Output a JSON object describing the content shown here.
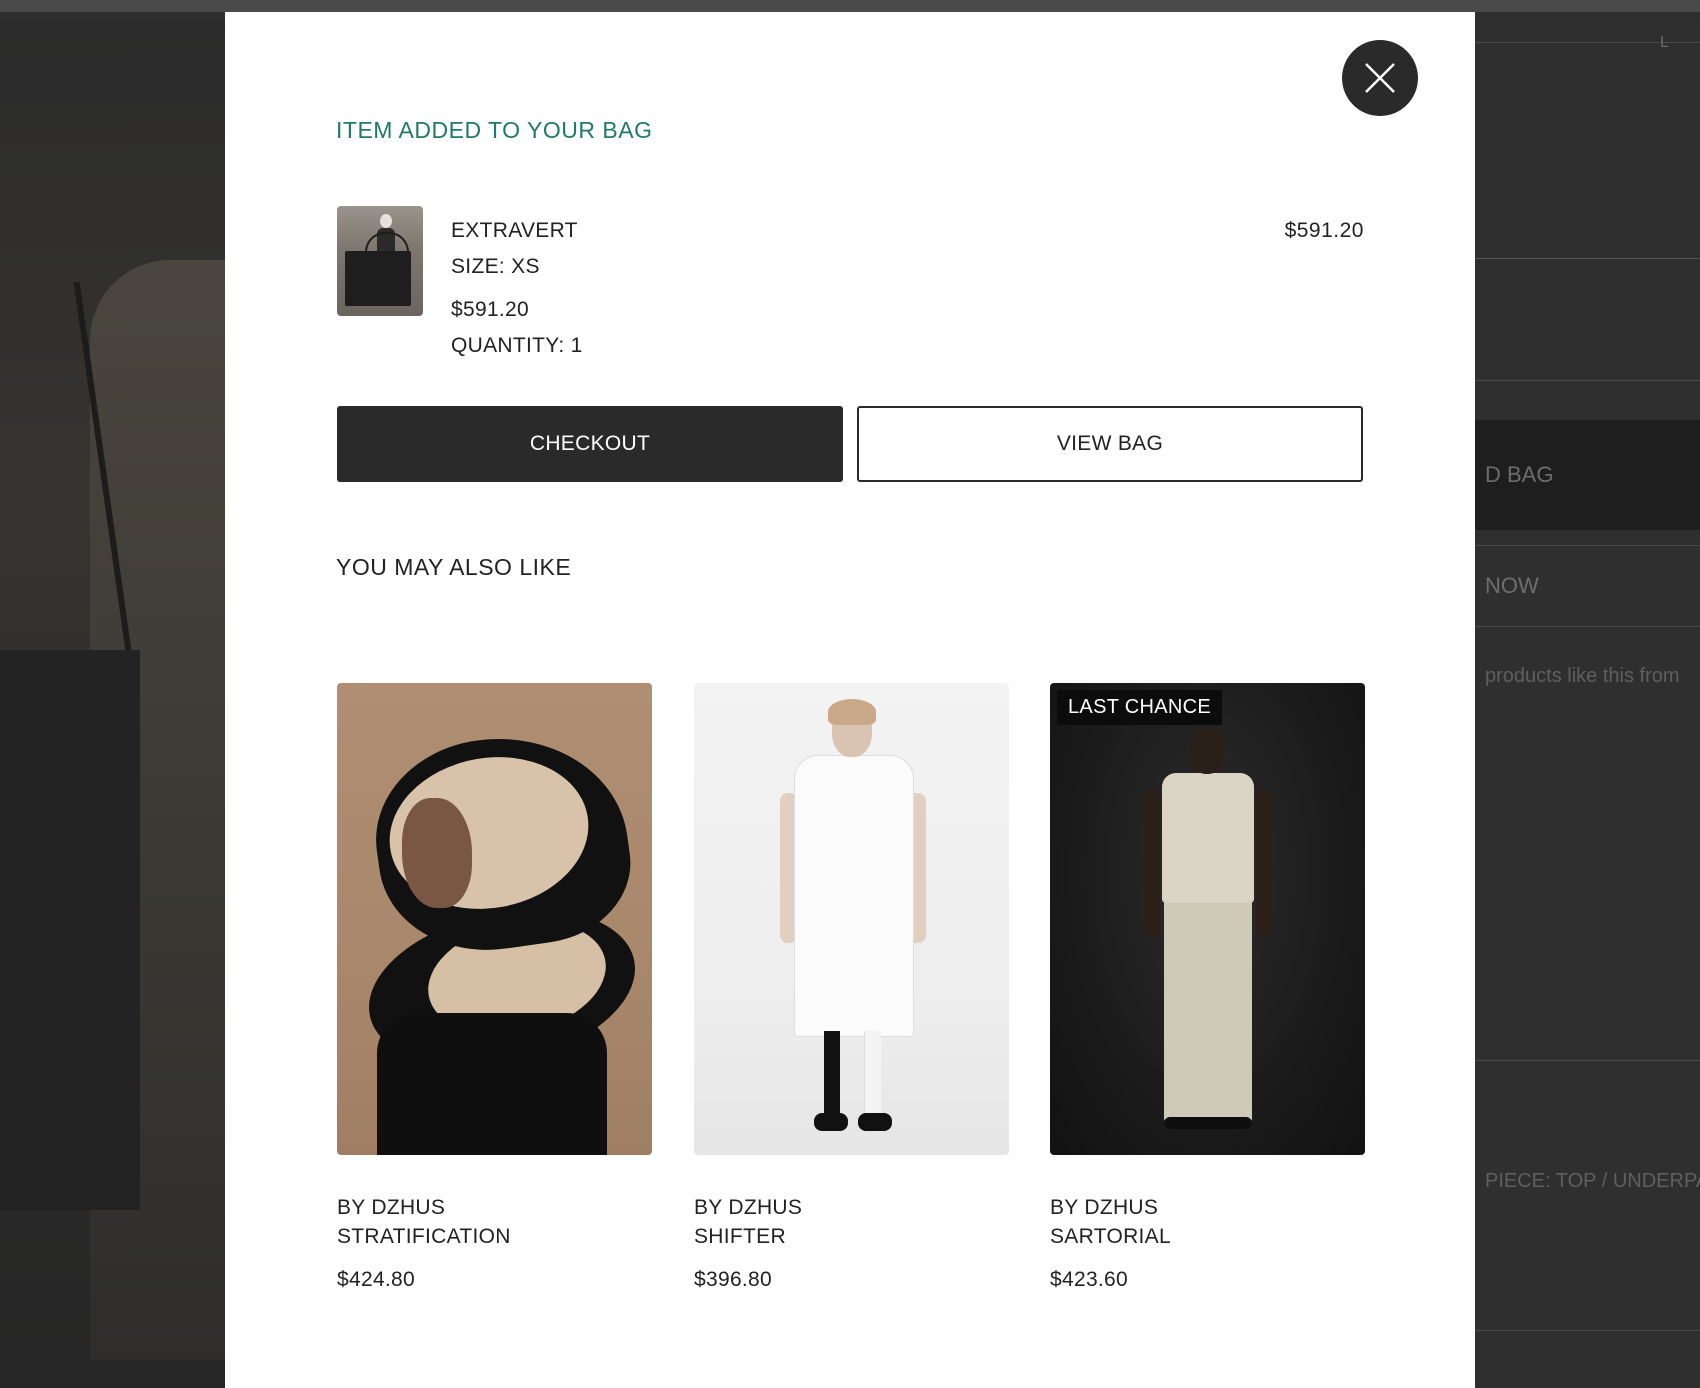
{
  "background_page": {
    "add_to_bag_partial": "D BAG",
    "buy_now_partial": "NOW",
    "products_partial": "products like this from",
    "piece_partial": "PIECE: TOP / UNDERPA",
    "corner_mark": "L"
  },
  "modal": {
    "close_label": "Close",
    "title": "ITEM ADDED TO YOUR BAG",
    "item": {
      "name": "EXTRAVERT",
      "size": "SIZE: XS",
      "price": "$591.20",
      "quantity": "QUANTITY: 1",
      "line_total": "$591.20"
    },
    "buttons": {
      "checkout": "CHECKOUT",
      "view_bag": "VIEW BAG"
    },
    "recommendations": {
      "heading": "YOU MAY ALSO LIKE",
      "products": [
        {
          "brand": "BY DZHUS",
          "name": "STRATIFICATION",
          "price": "$424.80",
          "badge": ""
        },
        {
          "brand": "BY DZHUS",
          "name": "SHIFTER",
          "price": "$396.80",
          "badge": ""
        },
        {
          "brand": "BY DZHUS",
          "name": "SARTORIAL",
          "price": "$423.60",
          "badge": "LAST CHANCE"
        }
      ]
    }
  },
  "colors": {
    "accent_green": "#1f7a68",
    "dark_button": "#2a2a2a",
    "overlay": "#2e2e2e"
  }
}
